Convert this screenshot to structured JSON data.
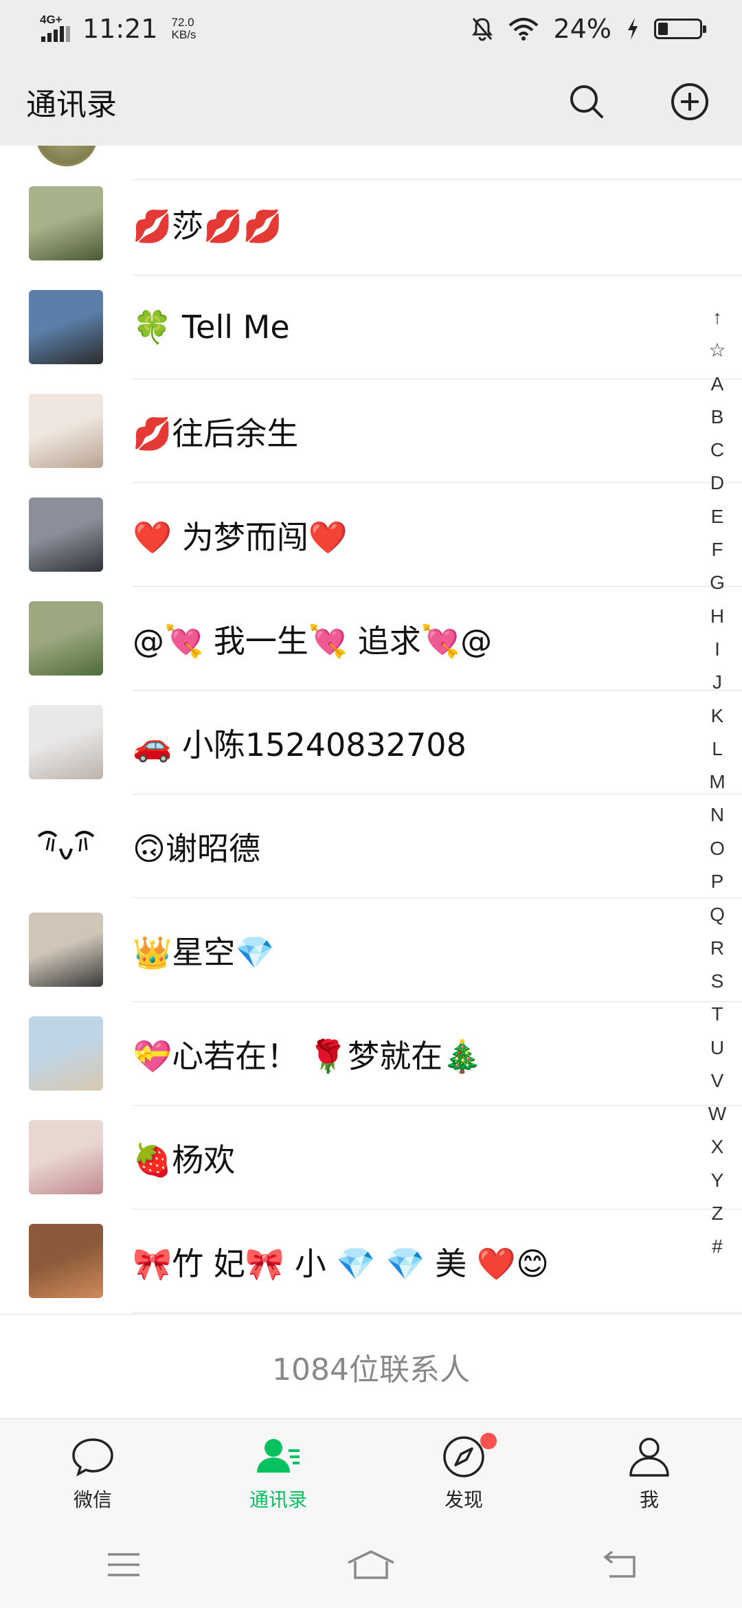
{
  "status_bar": {
    "network": "4G+",
    "time": "11:21",
    "speed_value": "72.0",
    "speed_unit": "KB/s",
    "battery_text": "24%",
    "battery_level": 0.24
  },
  "header": {
    "title": "通讯录",
    "icons": [
      "search-icon",
      "add-circle-icon"
    ]
  },
  "contacts": [
    {
      "name": "💋莎💋💋",
      "avatar_colors": [
        "#a8b28a",
        "#4a5a34"
      ]
    },
    {
      "name": "🍀 Tell   Me",
      "avatar_colors": [
        "#5b7fa8",
        "#2b2b2b"
      ]
    },
    {
      "name": "💋往后余生",
      "avatar_colors": [
        "#efe7df",
        "#b9a393"
      ]
    },
    {
      "name": "❤️ 为梦而闯❤️",
      "avatar_colors": [
        "#8a8f99",
        "#2f3238"
      ]
    },
    {
      "name": "@💘 我一生💘 追求💘@",
      "avatar_colors": [
        "#9ca880",
        "#4f6b3a"
      ]
    },
    {
      "name": "🚗 小陈15240832708",
      "avatar_colors": [
        "#e8e8e8",
        "#bdb2aa"
      ]
    },
    {
      "name": "🙃谢昭德",
      "avatar_colors": [
        "#ffffff",
        "#ffffff"
      ]
    },
    {
      "name": "👑星空💎",
      "avatar_colors": [
        "#cfc6b8",
        "#3a3a3a"
      ]
    },
    {
      "name": "💝心若在！ 🌹梦就在🎄",
      "avatar_colors": [
        "#bfd5e6",
        "#d9c8b0"
      ]
    },
    {
      "name": "🍓杨欢",
      "avatar_colors": [
        "#e8d7d0",
        "#c48a90"
      ]
    },
    {
      "name": "🎀竹 妃🎀 小 💎 💎 美 ❤️😊",
      "avatar_colors": [
        "#8a5a3a",
        "#d08a5a"
      ]
    }
  ],
  "index_letters": [
    "↑",
    "☆",
    "A",
    "B",
    "C",
    "D",
    "E",
    "F",
    "G",
    "H",
    "I",
    "J",
    "K",
    "L",
    "M",
    "N",
    "O",
    "P",
    "Q",
    "R",
    "S",
    "T",
    "U",
    "V",
    "W",
    "X",
    "Y",
    "Z",
    "#"
  ],
  "footer": {
    "count_text": "1084位联系人"
  },
  "tabs": [
    {
      "label": "微信",
      "icon": "chat-bubble-icon",
      "active": false
    },
    {
      "label": "通讯录",
      "icon": "contacts-icon",
      "active": true
    },
    {
      "label": "发现",
      "icon": "compass-icon",
      "active": false,
      "badge": true
    },
    {
      "label": "我",
      "icon": "person-icon",
      "active": false
    }
  ],
  "colors": {
    "accent": "#07c160",
    "badge": "#fa5151",
    "bar_bg": "#ededed"
  }
}
